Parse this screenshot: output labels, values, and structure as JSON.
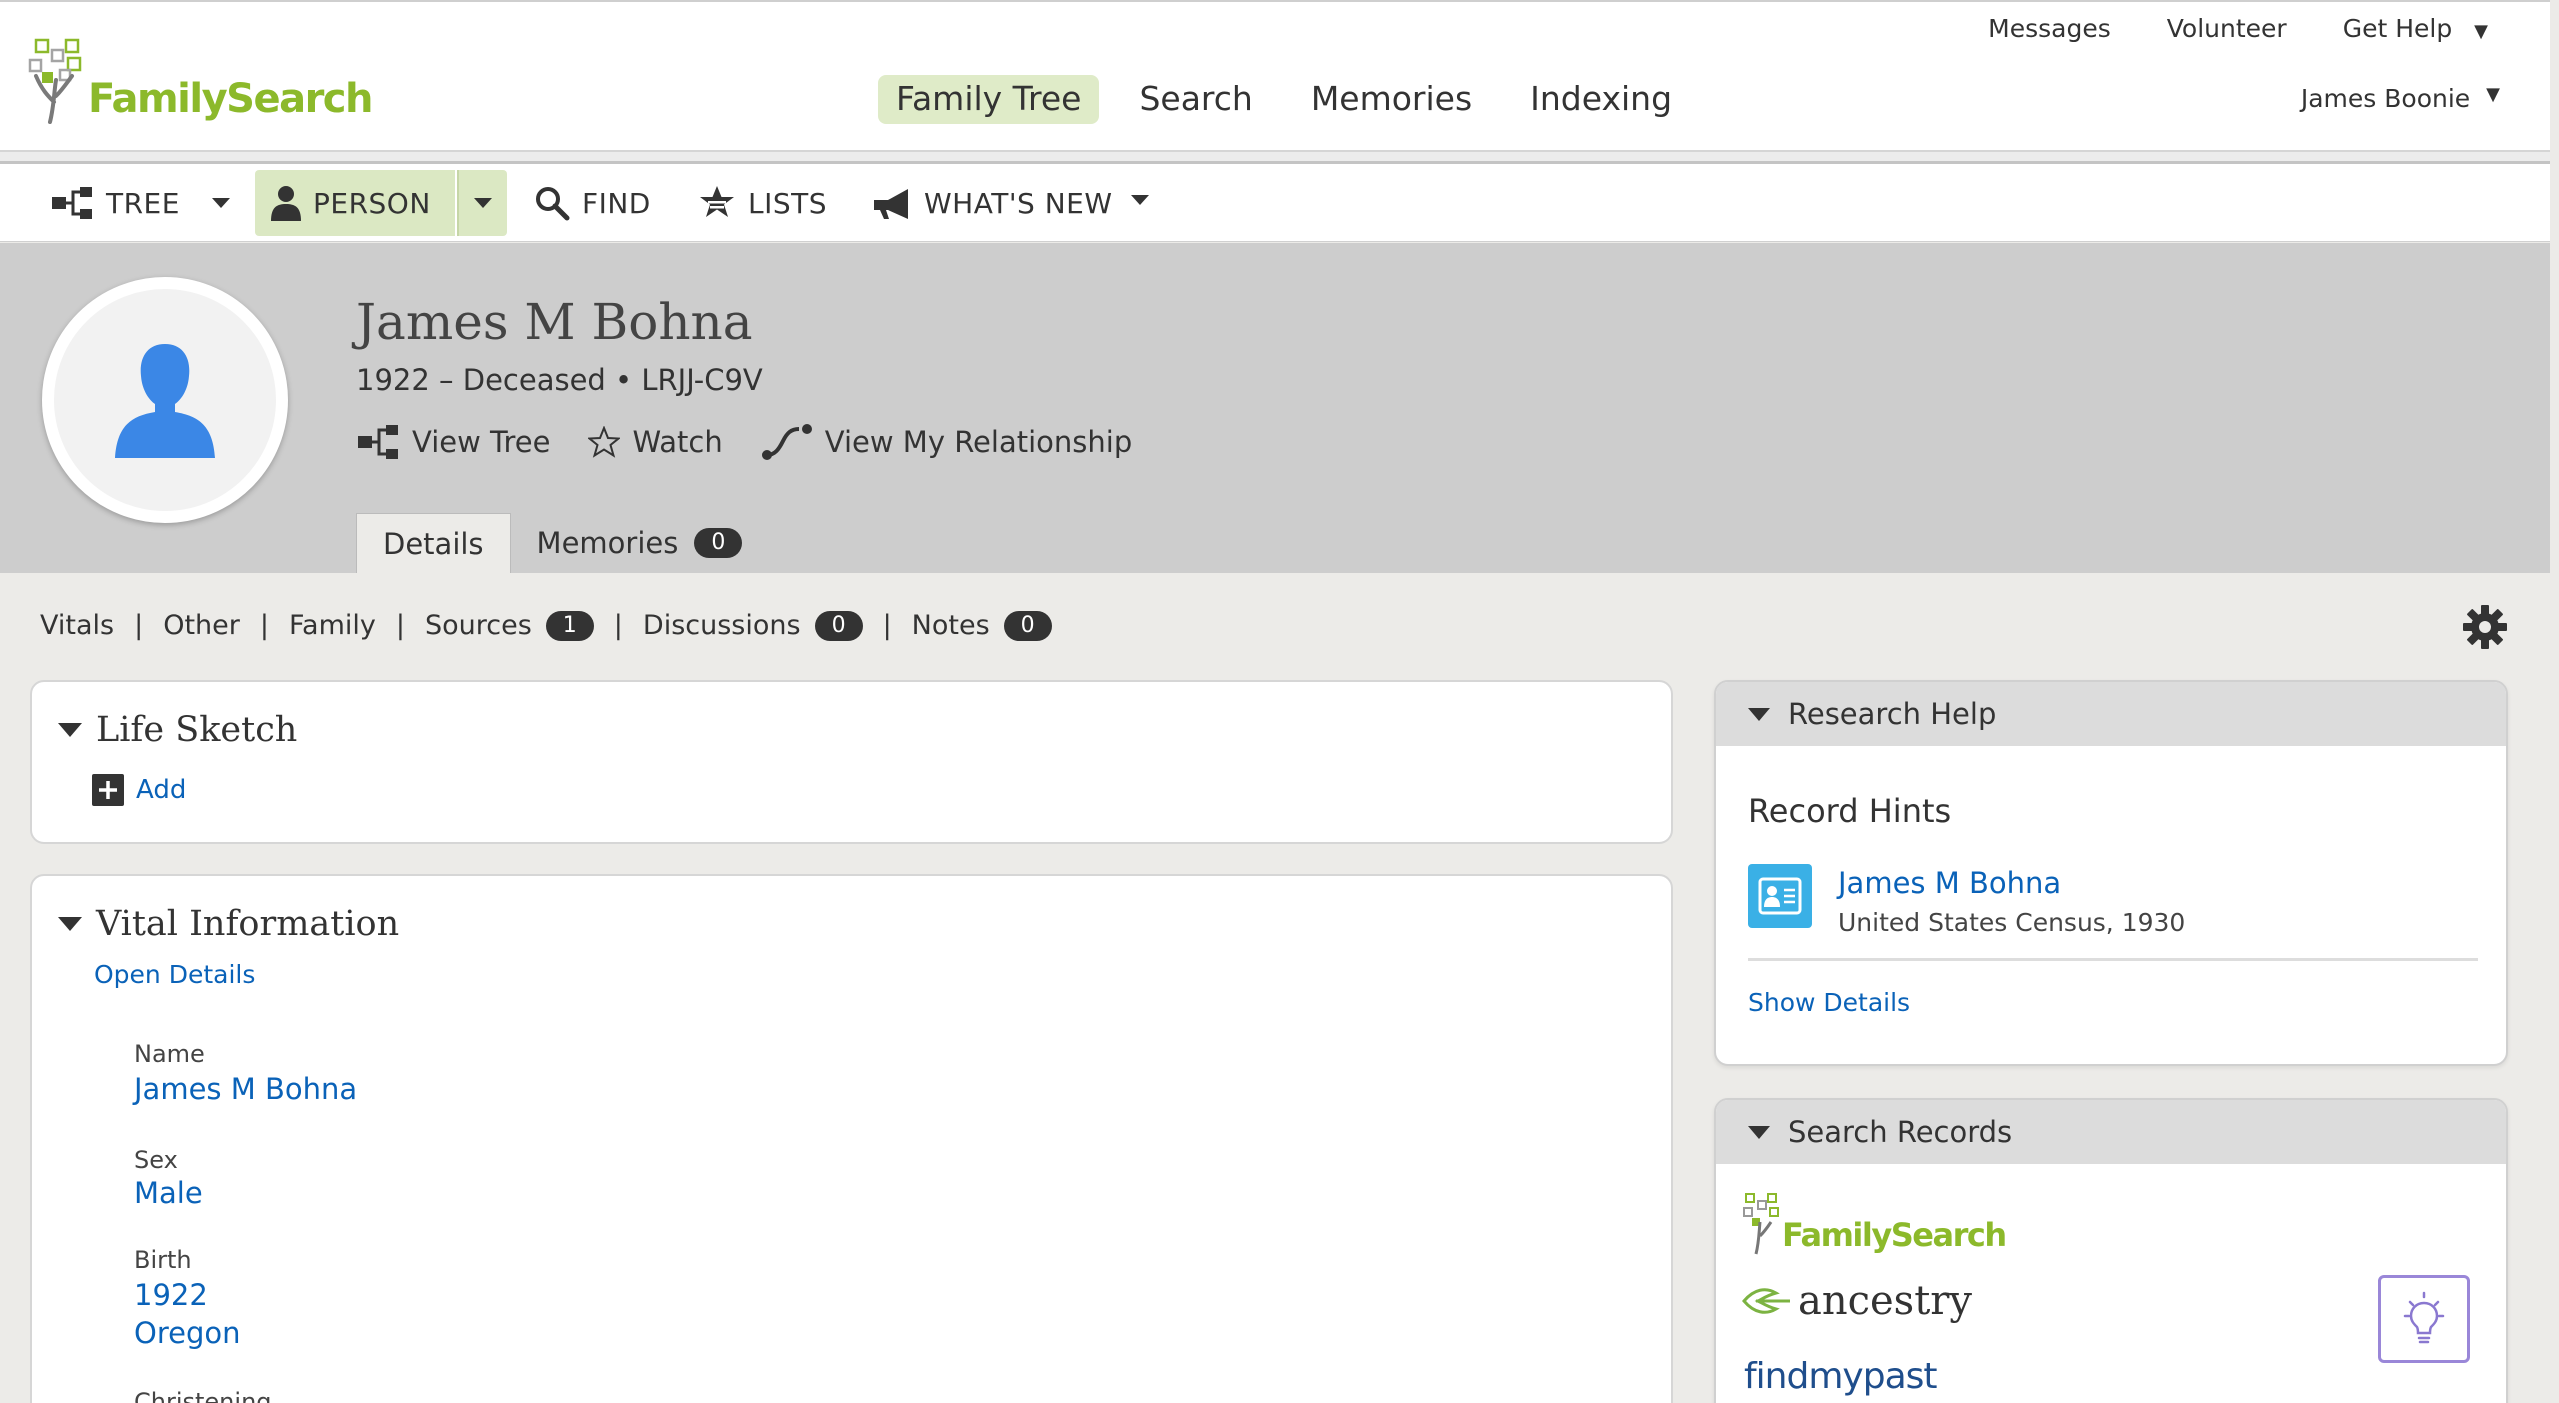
{
  "header": {
    "logo_text": "FamilySearch",
    "utility_links": [
      "Messages",
      "Volunteer",
      "Get Help"
    ],
    "get_help_caret": "▼",
    "main_nav": [
      {
        "label": "Family Tree",
        "active": true
      },
      {
        "label": "Search",
        "active": false
      },
      {
        "label": "Memories",
        "active": false
      },
      {
        "label": "Indexing",
        "active": false
      }
    ],
    "user_name": "James Boonie",
    "user_caret": "▼"
  },
  "toolbar": {
    "tree": "TREE",
    "person": "PERSON",
    "find": "FIND",
    "lists": "LISTS",
    "whats_new": "WHAT'S NEW"
  },
  "person": {
    "name": "James M Bohna",
    "meta": "1922 – Deceased • LRJJ-C9V",
    "actions": {
      "view_tree": "View Tree",
      "watch": "Watch",
      "view_relationship": "View My Relationship"
    },
    "tabs": {
      "details": "Details",
      "memories": "Memories",
      "memories_count": "0"
    }
  },
  "subnav": {
    "vitals": "Vitals",
    "other": "Other",
    "family": "Family",
    "sources": "Sources",
    "sources_count": "1",
    "discussions": "Discussions",
    "discussions_count": "0",
    "notes": "Notes",
    "notes_count": "0",
    "separator": "|"
  },
  "life_sketch": {
    "title": "Life Sketch",
    "add_label": "Add"
  },
  "vital_info": {
    "title": "Vital Information",
    "open_details": "Open Details",
    "name_label": "Name",
    "name_value": "James M Bohna",
    "sex_label": "Sex",
    "sex_value": "Male",
    "birth_label": "Birth",
    "birth_date": "1922",
    "birth_place": "Oregon",
    "christening_label": "Christening"
  },
  "research_help": {
    "title": "Research Help",
    "record_hints_heading": "Record Hints",
    "hint_name": "James M Bohna",
    "hint_source": "United States Census, 1930",
    "show_details": "Show Details"
  },
  "search_records": {
    "title": "Search Records",
    "providers": [
      "FamilySearch",
      "ancestry",
      "findmypast"
    ]
  },
  "colors": {
    "brand_green": "#8cb92b",
    "link_blue": "#0a62b8",
    "active_nav_bg": "#dfebc8",
    "banner_bg": "#cdcdcd",
    "avatar_blue": "#3b87e6"
  }
}
